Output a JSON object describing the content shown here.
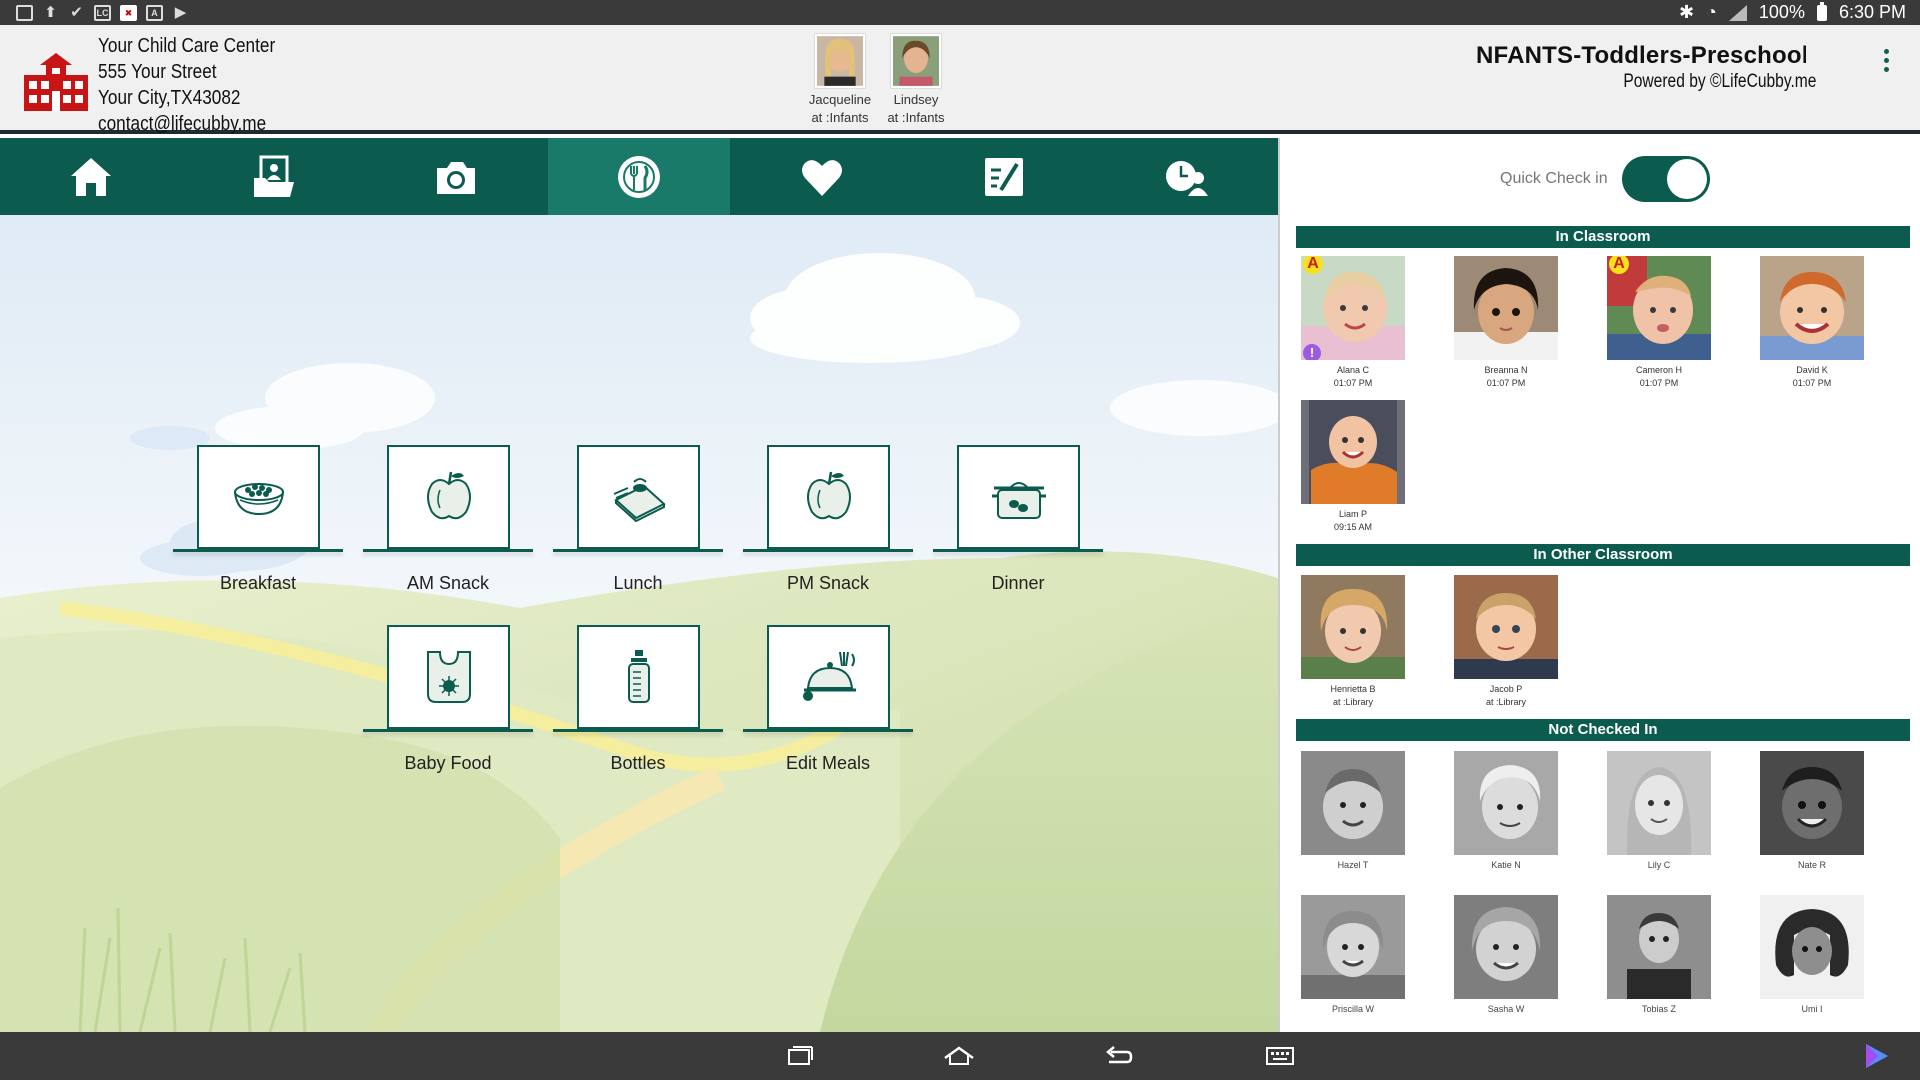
{
  "status_bar": {
    "battery": "100%",
    "time": "6:30 PM",
    "left_icons": [
      "image-icon",
      "upload-icon",
      "check-icon",
      "lc-icon",
      "red-x-icon",
      "a-icon",
      "play-store-icon"
    ]
  },
  "header": {
    "center_lines": [
      "Your Child Care Center",
      "555 Your Street",
      "Your City,TX43082",
      "contact@lifecubby.me"
    ],
    "staff": [
      {
        "name": "Jacqueline",
        "location": "at :Infants"
      },
      {
        "name": "Lindsey",
        "location": "at :Infants"
      }
    ],
    "classroom_title": "NFANTS-Toddlers-Preschool-",
    "powered_by": "Powered by ©LifeCubby.me"
  },
  "nav_tabs": [
    {
      "icon": "home-icon"
    },
    {
      "icon": "folder-user-icon"
    },
    {
      "icon": "camera-icon"
    },
    {
      "icon": "meal-icon",
      "active": true
    },
    {
      "icon": "heart-icon"
    },
    {
      "icon": "notes-icon"
    },
    {
      "icon": "clock-user-icon"
    }
  ],
  "meals": [
    {
      "label": "Breakfast",
      "icon": "cereal-bowl-icon"
    },
    {
      "label": "AM Snack",
      "icon": "apple-icon"
    },
    {
      "label": "Lunch",
      "icon": "lunch-tray-icon"
    },
    {
      "label": "PM Snack",
      "icon": "apple-icon"
    },
    {
      "label": "Dinner",
      "icon": "pot-icon"
    },
    {
      "label": "Baby Food",
      "icon": "bib-icon"
    },
    {
      "label": "Bottles",
      "icon": "bottle-icon"
    },
    {
      "label": "Edit Meals",
      "icon": "cloche-icon"
    }
  ],
  "right_panel": {
    "quick_check_label": "Quick Check in",
    "quick_check_on": true,
    "sections": {
      "in_classroom": "In  Classroom",
      "in_other": "In Other Classroom",
      "not_checked": "Not Checked In"
    },
    "in_classroom": [
      {
        "name": "Alana C",
        "time": "01:07 PM",
        "badges": [
          "A",
          "!"
        ]
      },
      {
        "name": "Breanna N",
        "time": "01:07 PM",
        "badges": []
      },
      {
        "name": "Cameron H",
        "time": "01:07 PM",
        "badges": [
          "A"
        ]
      },
      {
        "name": "David K",
        "time": "01:07 PM",
        "badges": []
      },
      {
        "name": "Liam P",
        "time": "09:15 AM",
        "badges": []
      }
    ],
    "in_other": [
      {
        "name": "Henrietta B",
        "time": "at :Library"
      },
      {
        "name": "Jacob P",
        "time": "at :Library"
      }
    ],
    "not_checked": [
      {
        "name": "Hazel T"
      },
      {
        "name": "Katie N"
      },
      {
        "name": "Lily C"
      },
      {
        "name": "Nate R"
      },
      {
        "name": "Priscilla W"
      },
      {
        "name": "Sasha W"
      },
      {
        "name": "Tobias Z"
      },
      {
        "name": "Umi I"
      }
    ]
  },
  "android_nav": [
    "recent-apps-icon",
    "home-nav-icon",
    "back-icon",
    "keyboard-icon",
    "play-icon"
  ],
  "colors": {
    "brand_green": "#0b5c4e",
    "active_tab": "#1a7a69",
    "badge_yellow": "#f7e11b",
    "badge_purple": "#9a5be0"
  }
}
